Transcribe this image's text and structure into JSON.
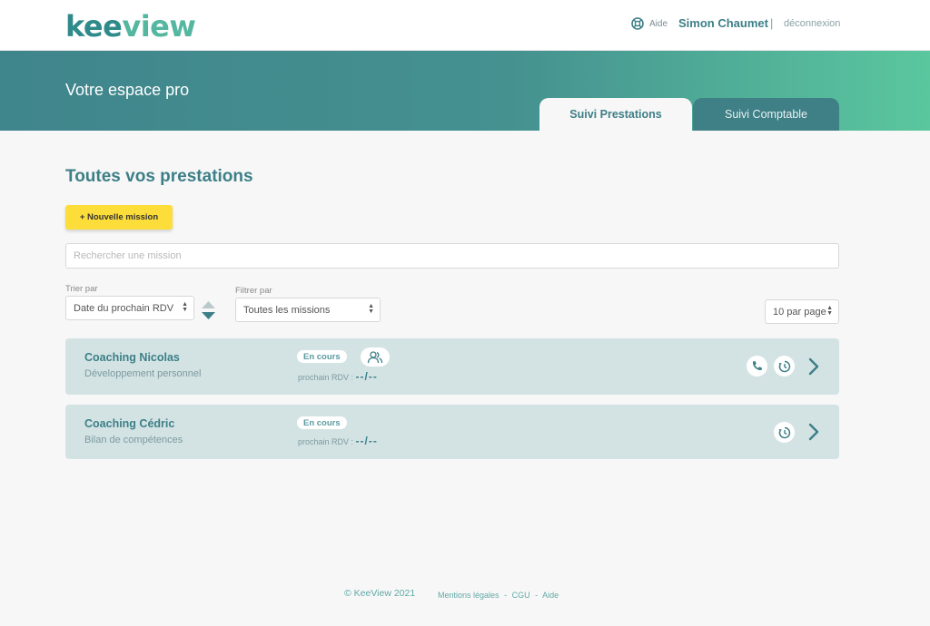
{
  "header": {
    "logo_part1": "kee",
    "logo_part2": "view",
    "help_label": "Aide",
    "user_name": "Simon Chaumet",
    "separator": "|",
    "logout_label": "déconnexion"
  },
  "hero": {
    "title": "Votre espace pro",
    "tabs": [
      {
        "label": "Suivi Prestations",
        "active": true
      },
      {
        "label": "Suivi Comptable",
        "active": false
      }
    ]
  },
  "main": {
    "title": "Toutes vos prestations",
    "new_mission_label": "+ Nouvelle mission",
    "search_placeholder": "Rechercher une mission",
    "sort": {
      "label": "Trier par",
      "value": "Date du prochain RDV"
    },
    "filter": {
      "label": "Filtrer par",
      "value": "Toutes les missions"
    },
    "per_page": {
      "value": "10 par page"
    }
  },
  "missions": [
    {
      "name": "Coaching Nicolas",
      "subtitle": "Développement personnel",
      "status": "En cours",
      "rdv_label": "prochain RDV :",
      "rdv_value": "--/--"
    },
    {
      "name": "Coaching Cédric",
      "subtitle": "Bilan de compétences",
      "status": "En cours",
      "rdv_label": "prochain RDV :",
      "rdv_value": "--/--"
    }
  ],
  "footer": {
    "copyright": "© KeeView 2021",
    "links": [
      "Mentions légales",
      "-",
      "CGU",
      "-",
      "Aide"
    ]
  },
  "colors": {
    "primary": "#3d7f87",
    "accent_yellow": "#fddd3a",
    "card_bg": "#d3e3e4",
    "gradient_end": "#5ac79e"
  },
  "icons": {
    "help": "lifebuoy-icon",
    "group": "users-icon",
    "phone": "phone-icon",
    "history": "history-clock-icon",
    "open": "chevron-right-icon",
    "sort": "sort-toggle-icon"
  }
}
